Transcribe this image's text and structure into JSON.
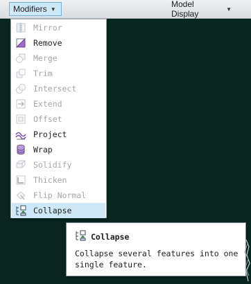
{
  "toolbar": {
    "modifiers_label": "Modifiers",
    "model_display_label": "Model Display"
  },
  "menu": {
    "items": [
      {
        "label": "Mirror",
        "icon": "mirror-icon",
        "enabled": false
      },
      {
        "label": "Remove",
        "icon": "remove-icon",
        "enabled": true
      },
      {
        "label": "Merge",
        "icon": "merge-icon",
        "enabled": false
      },
      {
        "label": "Trim",
        "icon": "trim-icon",
        "enabled": false
      },
      {
        "label": "Intersect",
        "icon": "intersect-icon",
        "enabled": false
      },
      {
        "label": "Extend",
        "icon": "extend-icon",
        "enabled": false
      },
      {
        "label": "Offset",
        "icon": "offset-icon",
        "enabled": false
      },
      {
        "label": "Project",
        "icon": "project-icon",
        "enabled": true
      },
      {
        "label": "Wrap",
        "icon": "wrap-icon",
        "enabled": true
      },
      {
        "label": "Solidify",
        "icon": "solidify-icon",
        "enabled": false
      },
      {
        "label": "Thicken",
        "icon": "thicken-icon",
        "enabled": false
      },
      {
        "label": "Flip Normal",
        "icon": "flip-normal-icon",
        "enabled": false
      },
      {
        "label": "Collapse",
        "icon": "collapse-icon",
        "enabled": true,
        "highlighted": true
      }
    ]
  },
  "tooltip": {
    "title": "Collapse",
    "icon": "collapse-icon",
    "description": "Collapse several features into one single feature."
  },
  "colors": {
    "background": "#08261f",
    "highlight": "#cfe8f8",
    "active_tab": "#cde8f7",
    "disabled_text": "#a6a6a6"
  }
}
